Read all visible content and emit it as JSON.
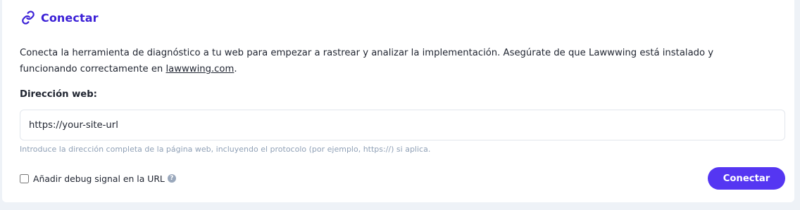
{
  "header": {
    "icon": "link-icon",
    "title": "Conectar"
  },
  "description": {
    "text": "Conecta la herramienta de diagnóstico a tu web para empezar a rastrear y analizar la implementación. Asegúrate de que Lawwwing está instalado y funcionando correctamente en ",
    "link_text": "lawwwing.com",
    "suffix": "."
  },
  "url_field": {
    "label": "Dirección web:",
    "value": "https://your-site-url",
    "hint": "Introduce la dirección completa de la página web, incluyendo el protocolo (por ejemplo, https://) si aplica."
  },
  "debug_option": {
    "label": "Añadir debug signal en la URL",
    "checked": false,
    "help_icon": "question-icon",
    "help_glyph": "?"
  },
  "actions": {
    "connect_label": "Conectar"
  },
  "colors": {
    "accent": "#5536f2",
    "title": "#3a1fd6",
    "hint": "#8fa0b6"
  }
}
